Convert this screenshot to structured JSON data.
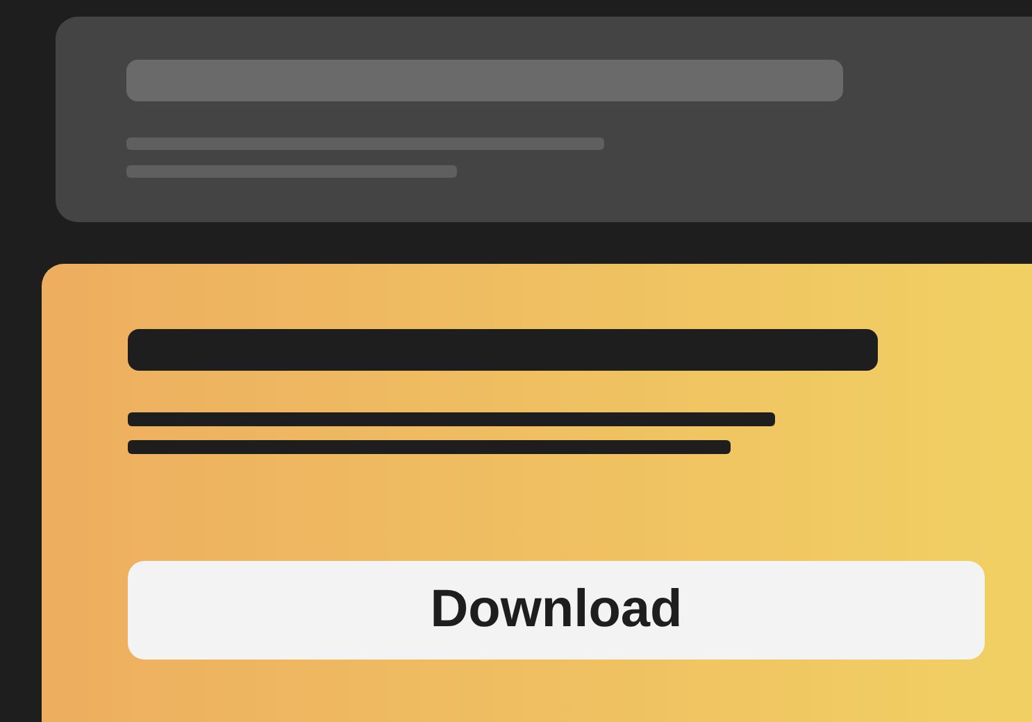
{
  "download_button": {
    "label": "Download"
  }
}
